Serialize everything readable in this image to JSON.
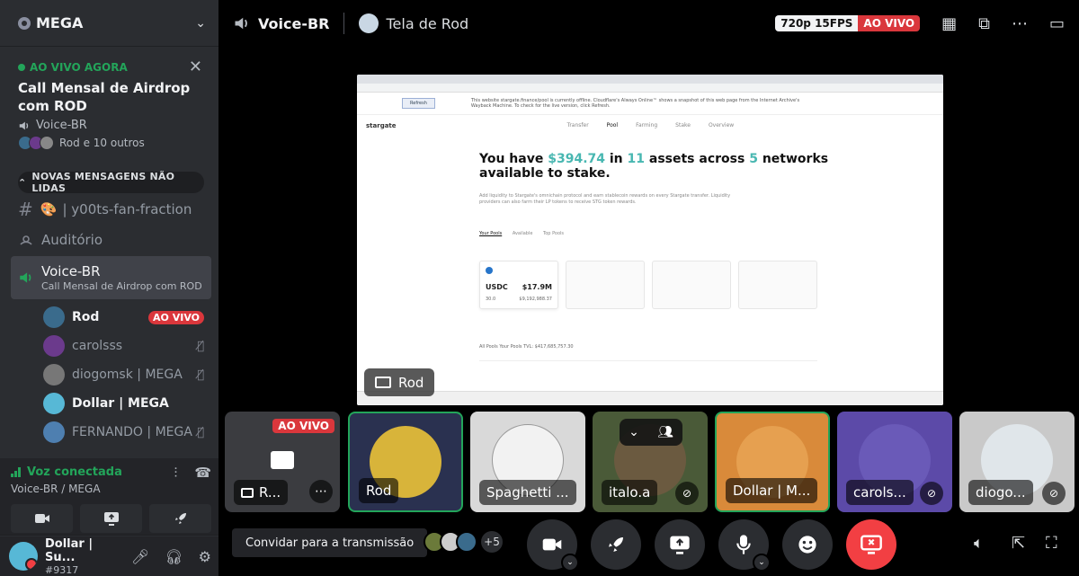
{
  "sidebar": {
    "server_name": "MEGA",
    "live_now": "AO VIVO AGORA",
    "event_title": "Call Mensal de Airdrop com ROD",
    "event_channel": "Voice-BR",
    "event_users": "Rod e 10 outros",
    "unread_pill": "NOVAS MENSAGENS NÃO LIDAS",
    "channels": [
      {
        "type": "text",
        "emoji": "🎨",
        "name": "| y00ts-fan-fraction"
      },
      {
        "type": "stage",
        "name": "Auditório"
      }
    ],
    "active_channel": {
      "name": "Voice-BR",
      "subtitle": "Call Mensal de Airdrop com ROD"
    },
    "voice_users": [
      {
        "name": "Rod",
        "badge": "AO VIVO",
        "color": "#3a6b8c"
      },
      {
        "name": "carolsss",
        "muted": true,
        "color": "#6b3a8c"
      },
      {
        "name": "diogomsk | MEGA",
        "muted": true,
        "color": "#777777"
      },
      {
        "name": "Dollar | MEGA",
        "color": "#57b8d6"
      },
      {
        "name": "FERNANDO | MEGA",
        "muted": true,
        "color": "#4e7fb0"
      }
    ],
    "voice_status": "Voz conectada",
    "voice_location": "Voice-BR / MEGA",
    "user_name": "Dollar | Su...",
    "user_tag": "#9317"
  },
  "topbar": {
    "channel": "Voice-BR",
    "stream_title": "Tela de Rod",
    "quality": "720p 15FPS",
    "live": "AO VIVO"
  },
  "stream": {
    "browser_notice": "This website stargate.finance/pool is currently offline. Cloudflare's Always Online™ shows a snapshot of this web page from the Internet Archive's Wayback Machine. To check for the live version, click Refresh.",
    "refresh": "Refresh",
    "brand": "stargate",
    "nav": [
      "Transfer",
      "Pool",
      "Farming",
      "Stake",
      "Overview"
    ],
    "headline_pre": "You have ",
    "amount": "$394.74",
    "headline_mid": " in ",
    "assets": "11",
    "headline_mid2": " assets across ",
    "networks": "5",
    "headline_post": " networks",
    "headline_line2": "available to stake.",
    "description": "Add liquidity to Stargate's omnichain protocol and earn stablecoin rewards on every Stargate transfer. Liquidity providers can also farm their LP tokens to receive STG token rewards.",
    "pool_tabs": [
      "Your Pools",
      "Available",
      "Top Pools"
    ],
    "card_token": "USDC",
    "card_value": "$17.9M",
    "card_small1": "30.0",
    "card_small2": "$9,192,988.37",
    "all_pools": "All Pools   Your Pools   TVL: $417,685,757.30",
    "presenter": "Rod"
  },
  "tiles": [
    {
      "label": "R...",
      "live": "AO VIVO"
    },
    {
      "label": "Rod"
    },
    {
      "label": "Spaghetti ..."
    },
    {
      "label": "italo.a"
    },
    {
      "label": "Dollar | M..."
    },
    {
      "label": "carols..."
    },
    {
      "label": "diogo..."
    }
  ],
  "bottom": {
    "invite": "Convidar para a transmissão",
    "viewer_count": "+5"
  },
  "colors": {
    "accent_green": "#23a55a",
    "live_red": "#da373c",
    "stargate_teal": "#48b7b1"
  }
}
